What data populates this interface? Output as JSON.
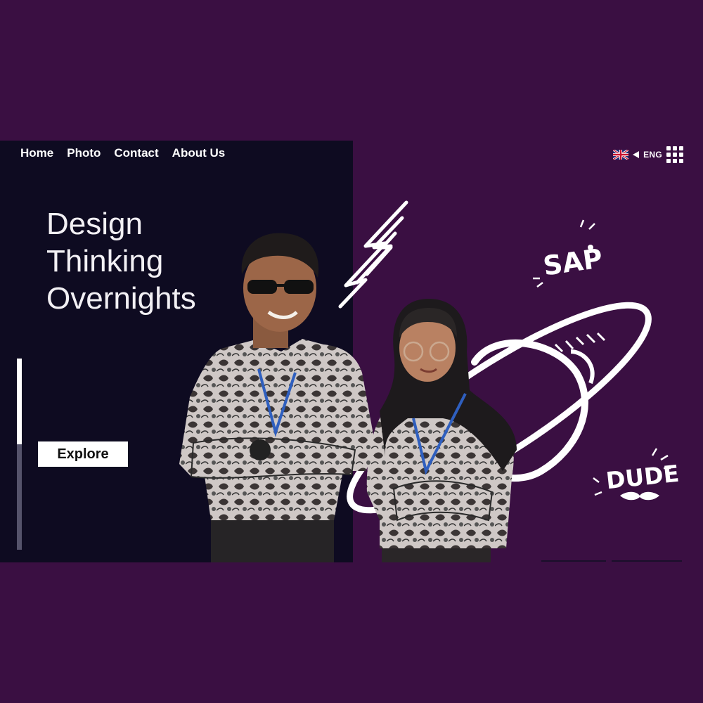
{
  "nav": {
    "items": [
      {
        "label": "Home"
      },
      {
        "label": "Photo"
      },
      {
        "label": "Contact"
      },
      {
        "label": "About Us"
      }
    ]
  },
  "language": {
    "code": "ENG",
    "flag_icon": "uk-flag-icon",
    "menu_icon": "grid-menu-icon"
  },
  "hero": {
    "title_lines": [
      "Design",
      "Thinking",
      "Overnights"
    ],
    "cta_label": "Explore"
  },
  "scroll_progress": 0.45,
  "doodles": {
    "sap_text": "SAP",
    "dude_text": "DUDE"
  },
  "colors": {
    "background": "#3a0f42",
    "left_panel": "#0e0b21",
    "text": "#ffffff"
  }
}
